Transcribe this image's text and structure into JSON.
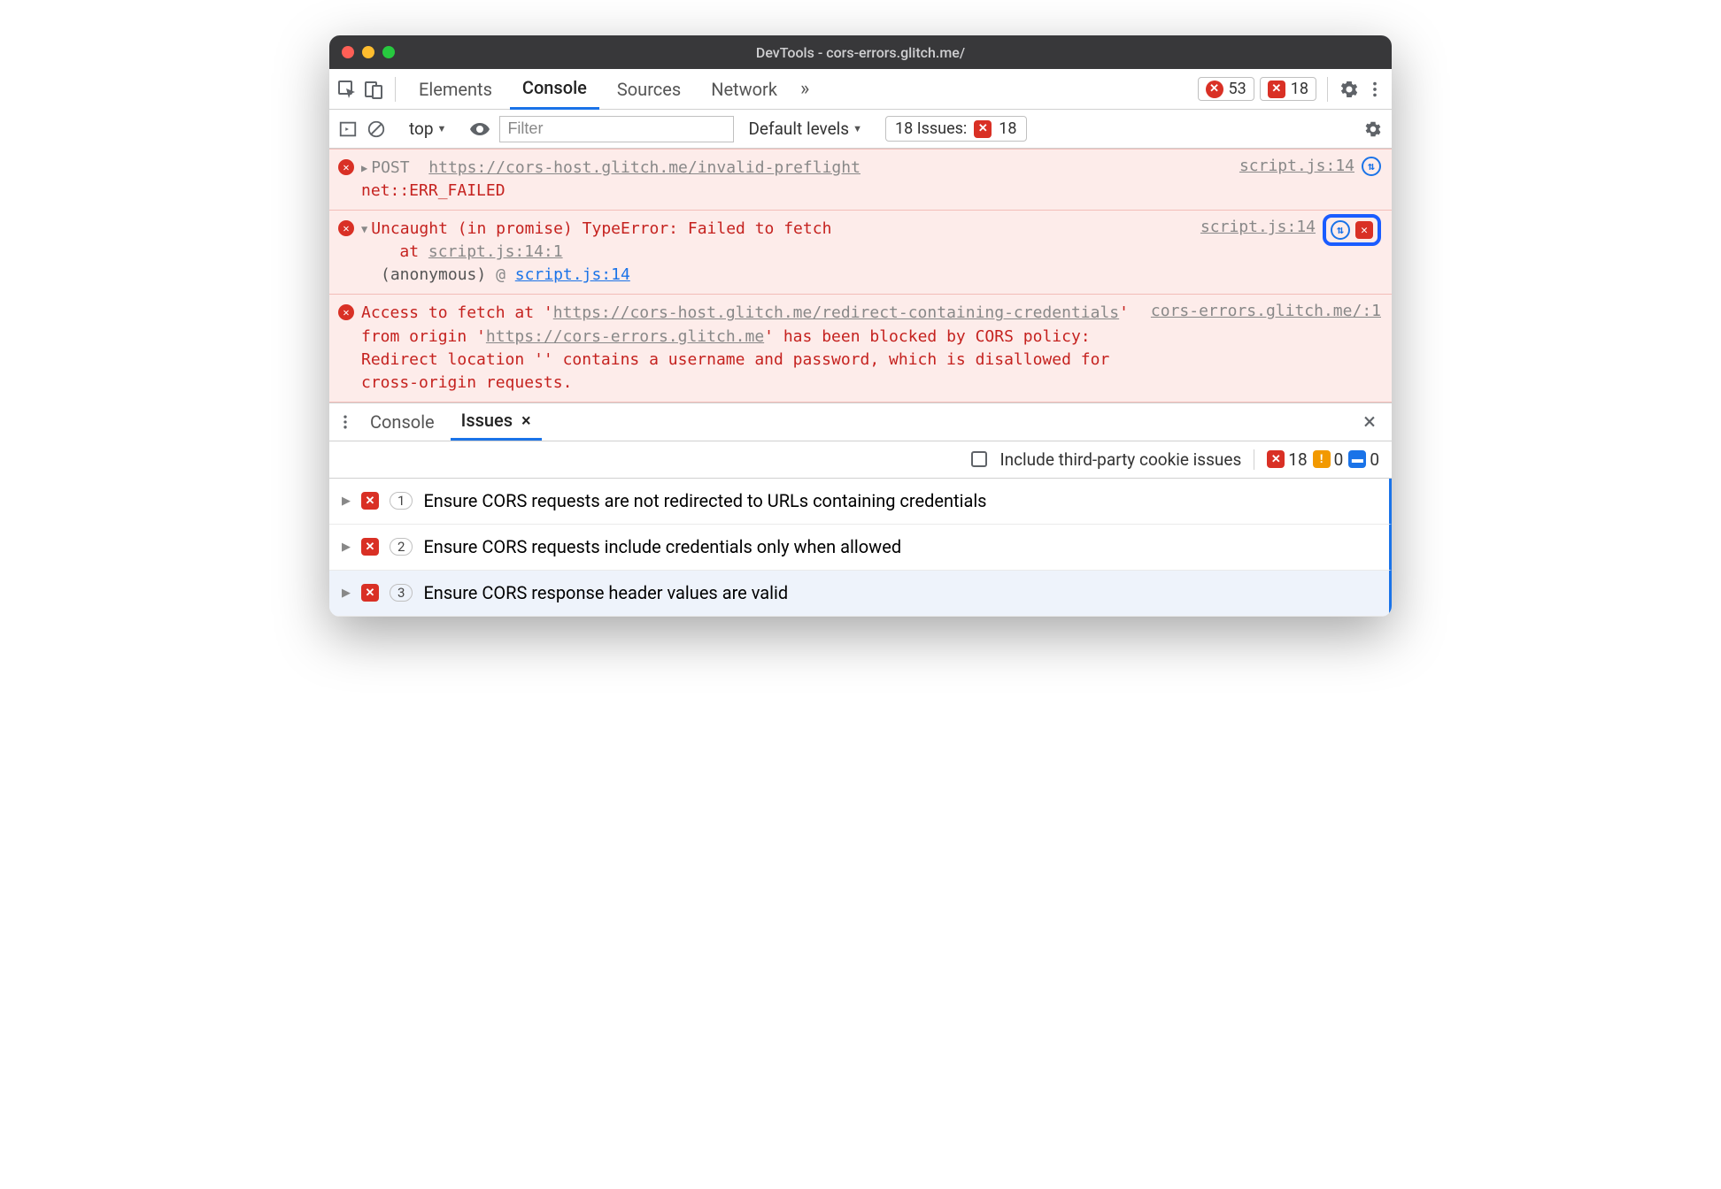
{
  "window": {
    "title": "DevTools - cors-errors.glitch.me/"
  },
  "main_tabs": {
    "items": [
      "Elements",
      "Console",
      "Sources",
      "Network"
    ],
    "active": "Console",
    "overflow_glyph": "»"
  },
  "toolbar_badges": {
    "error_count": "53",
    "issue_count": "18"
  },
  "console_toolbar": {
    "context": "top",
    "filter_placeholder": "Filter",
    "levels_label": "Default levels",
    "issues_label": "18 Issues:",
    "issues_count": "18"
  },
  "messages": [
    {
      "method": "POST",
      "url": "https://cors-host.glitch.me/invalid-preflight",
      "status": "net::ERR_FAILED",
      "source": "script.js:14",
      "expand_glyph": "▶"
    },
    {
      "headline": "Uncaught (in promise) TypeError: Failed to fetch",
      "at_prefix": "at ",
      "at_link": "script.js:14:1",
      "stack_label": "(anonymous)",
      "stack_sep": "@",
      "stack_link": "script.js:14",
      "source": "script.js:14",
      "expand_glyph": "▼"
    },
    {
      "pre": "Access to fetch at '",
      "url": "https://cors-host.glitch.me/redirect-containing-credentials",
      "mid1": "' from origin '",
      "origin": "https://cors-errors.glitch.me",
      "mid2": "' has been blocked by CORS policy: Redirect location '' contains a username and password, which is disallowed for cross-origin requests.",
      "source": "cors-errors.glitch.me/:1"
    }
  ],
  "drawer": {
    "tabs": [
      "Console",
      "Issues"
    ],
    "active": "Issues",
    "close_glyph": "×",
    "filter": {
      "checkbox_label": "Include third-party cookie issues",
      "counts": {
        "errors": "18",
        "warnings": "0",
        "info": "0"
      }
    },
    "issues": [
      {
        "count": "1",
        "title": "Ensure CORS requests are not redirected to URLs containing credentials"
      },
      {
        "count": "2",
        "title": "Ensure CORS requests include credentials only when allowed"
      },
      {
        "count": "3",
        "title": "Ensure CORS response header values are valid"
      }
    ]
  },
  "glyphs": {
    "net_arrows": "⇅",
    "x": "✕",
    "warn": "!",
    "chat": "▬"
  }
}
